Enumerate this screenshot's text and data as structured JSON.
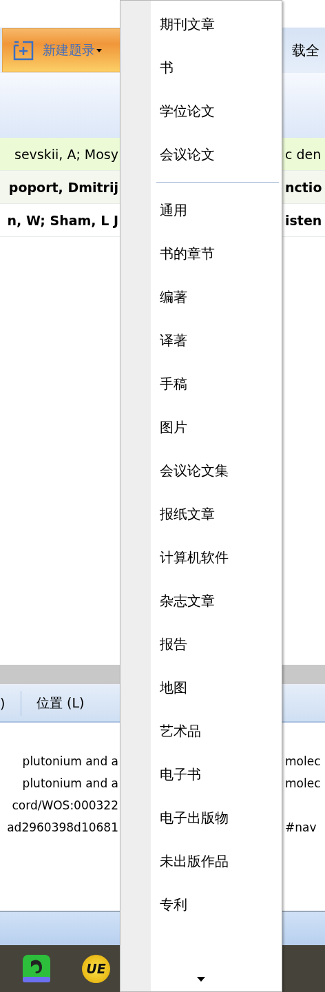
{
  "toolbar": {
    "new_button": {
      "label": "新建题录"
    },
    "right_label": "载全"
  },
  "records": [
    {
      "left": "sevskii, A; Mosy",
      "right": "c den",
      "selected": true
    },
    {
      "left": "poport, Dmitrij",
      "right": "nctio",
      "selected": false
    },
    {
      "left": "n, W; Sham, L J",
      "right": "isten",
      "selected": false
    }
  ],
  "details": {
    "columns": [
      ")",
      "位置 (L)"
    ],
    "lines": [
      {
        "left": "plutonium and a",
        "right": "molec"
      },
      {
        "left": "plutonium and a",
        "right": "molec"
      },
      {
        "left": "cord/WOS:000322"
      },
      {
        "left": "ad2960398d10681",
        "right": "#nav"
      }
    ]
  },
  "taskbar": {
    "apps": [
      {
        "kind": "evernote"
      },
      {
        "kind": "ue",
        "label": "UE"
      }
    ]
  },
  "menu": {
    "groups": [
      [
        "期刊文章",
        "书",
        "学位论文",
        "会议论文"
      ],
      [
        "通用",
        "书的章节",
        "编著",
        "译著",
        "手稿",
        "图片",
        "会议论文集",
        "报纸文章",
        "计算机软件",
        "杂志文章",
        "报告",
        "地图",
        "艺术品",
        "电子书",
        "电子出版物",
        "未出版作品",
        "专利"
      ]
    ]
  }
}
